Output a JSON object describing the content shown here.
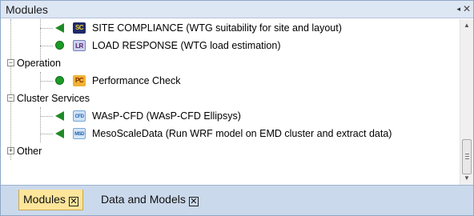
{
  "panel": {
    "title": "Modules",
    "pin_glyph": "◂",
    "close_glyph": "✕"
  },
  "tree": {
    "rows": [
      {
        "kind": "module",
        "status": "triangle",
        "icon_text": "SC",
        "icon": "site-compliance-icon",
        "label": "SITE COMPLIANCE (WTG suitability for site and layout)"
      },
      {
        "kind": "module",
        "status": "dot",
        "icon_text": "LR",
        "icon": "load-response-icon",
        "label": "LOAD RESPONSE (WTG load estimation)"
      },
      {
        "kind": "category",
        "expanded": true,
        "toggle": "−",
        "label": "Operation"
      },
      {
        "kind": "module",
        "status": "dot",
        "icon_text": "PC",
        "icon": "performance-check-icon",
        "label": "Performance Check"
      },
      {
        "kind": "category",
        "expanded": true,
        "toggle": "−",
        "label": "Cluster Services"
      },
      {
        "kind": "module",
        "status": "triangle",
        "icon_text": "CFD",
        "icon": "wasp-cfd-icon",
        "label": "WAsP-CFD (WAsP-CFD Ellipsys)"
      },
      {
        "kind": "module",
        "status": "triangle",
        "icon_text": "MSD",
        "icon": "mesoscale-data-icon",
        "label": "MesoScaleData (Run WRF model on EMD cluster and extract data)"
      },
      {
        "kind": "category",
        "expanded": false,
        "toggle": "+",
        "label": "Other"
      }
    ]
  },
  "scrollbar": {
    "up": "▲",
    "down": "▼"
  },
  "tabs": [
    {
      "label": "Modules",
      "active": true,
      "close": "✕"
    },
    {
      "label": "Data and Models",
      "active": false,
      "close": "✕"
    }
  ],
  "colors": {
    "status_green": "#1b9c28",
    "titlebar": "#dde6f3",
    "active_tab": "#fde59a",
    "tabbar": "#cbd9ec"
  }
}
